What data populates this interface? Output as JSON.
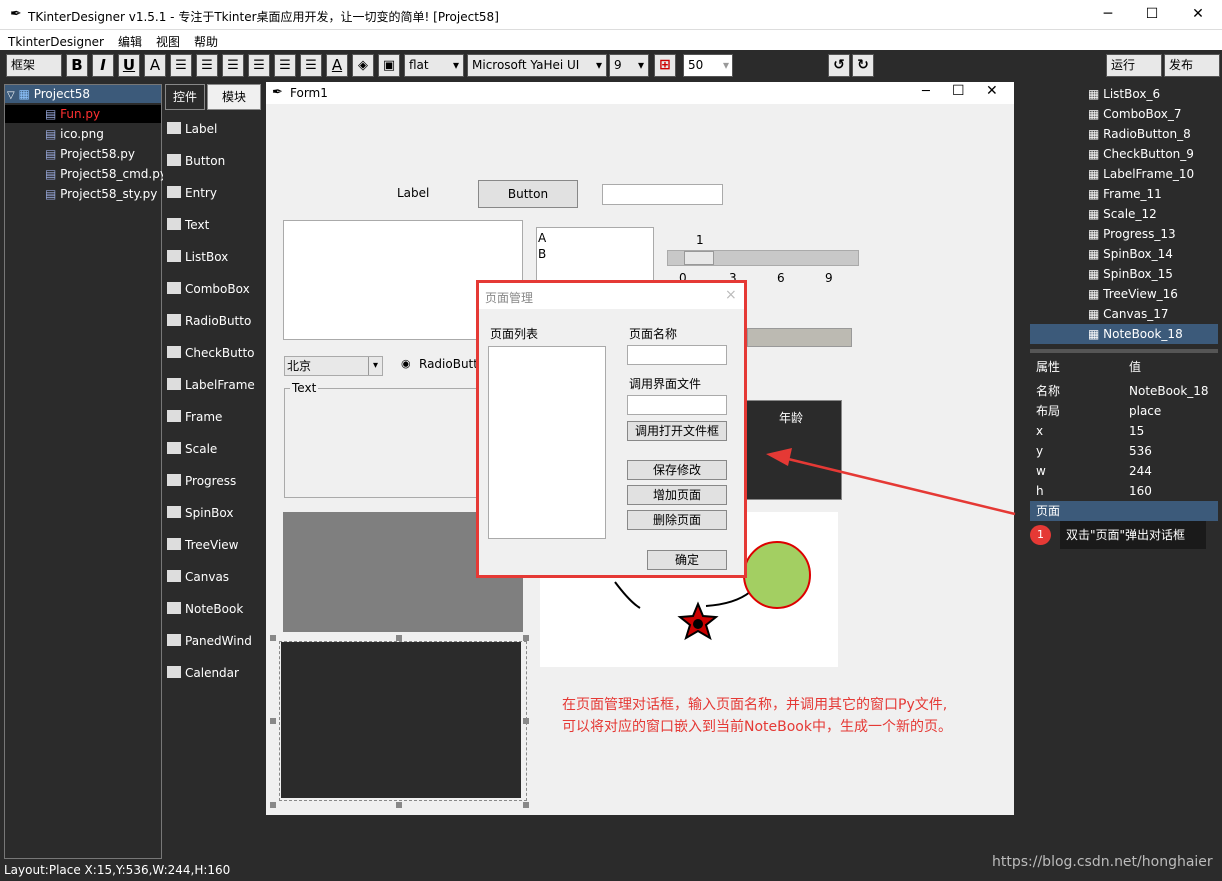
{
  "window": {
    "title": "TKinterDesigner v1.5.1 - 专注于Tkinter桌面应用开发，让一切变的简单!    [Project58]",
    "min": "─",
    "max": "☐",
    "close": "✕"
  },
  "menu": [
    "TkinterDesigner",
    "编辑",
    "视图",
    "帮助"
  ],
  "toolbar": {
    "frame_select": "框架",
    "relief": "flat",
    "font": "Microsoft YaHei UI",
    "font_size": "9",
    "grid_size": "50",
    "run": "运行",
    "publish": "发布",
    "bold": "B",
    "italic": "I",
    "underline": "U",
    "fontcolor": "A"
  },
  "project_tree": {
    "root": "Project58",
    "files": [
      {
        "name": "Fun.py",
        "color": "#ff3030",
        "selected": true
      },
      {
        "name": "ico.png",
        "color": "#ffffff",
        "selected": false
      },
      {
        "name": "Project58.py",
        "color": "#ffffff",
        "selected": false
      },
      {
        "name": "Project58_cmd.py",
        "color": "#ffffff",
        "selected": false
      },
      {
        "name": "Project58_sty.py",
        "color": "#ffffff",
        "selected": false
      }
    ]
  },
  "palette": {
    "tabs": [
      "控件",
      "模块"
    ],
    "items": [
      "Label",
      "Button",
      "Entry",
      "Text",
      "ListBox",
      "ComboBox",
      "RadioButto",
      "CheckButto",
      "LabelFrame",
      "Frame",
      "Scale",
      "Progress",
      "SpinBox",
      "TreeView",
      "Canvas",
      "NoteBook",
      "PanedWind",
      "Calendar"
    ]
  },
  "form": {
    "title": "Form1",
    "label": "Label",
    "button": "Button",
    "listbox_items": [
      "A",
      "B"
    ],
    "scale_value": "1",
    "scale_ticks": [
      "0",
      "3",
      "6",
      "9"
    ],
    "combo_value": "北京",
    "radio_label": "RadioButt",
    "labelframe_title": "Text",
    "tree_header": "年龄"
  },
  "dialog": {
    "title": "页面管理",
    "close": "×",
    "list_label": "页面列表",
    "name_label": "页面名称",
    "file_label": "调用界面文件",
    "open_button": "调用打开文件框",
    "save_button": "保存修改",
    "add_button": "增加页面",
    "delete_button": "删除页面",
    "ok_button": "确定"
  },
  "annotation": {
    "line1": "在页面管理对话框，输入页面名称，并调用其它的窗口Py文件,",
    "line2": "可以将对应的窗口嵌入到当前NoteBook中，生成一个新的页。",
    "badge": "1",
    "tooltip": "双击\"页面\"弹出对话框",
    "color": "#e53935"
  },
  "object_list": [
    "ListBox_6",
    "ComboBox_7",
    "RadioButton_8",
    "CheckButton_9",
    "LabelFrame_10",
    "Frame_11",
    "Scale_12",
    "Progress_13",
    "SpinBox_14",
    "SpinBox_15",
    "TreeView_16",
    "Canvas_17",
    "NoteBook_18"
  ],
  "properties": {
    "header": {
      "name": "属性",
      "value": "值"
    },
    "rows": [
      {
        "name": "名称",
        "value": "NoteBook_18"
      },
      {
        "name": "布局",
        "value": "place"
      },
      {
        "name": "x",
        "value": "15"
      },
      {
        "name": "y",
        "value": "536"
      },
      {
        "name": "w",
        "value": "244"
      },
      {
        "name": "h",
        "value": "160"
      },
      {
        "name": "页面",
        "value": ""
      }
    ]
  },
  "status": {
    "text": "Layout:Place  X:15,Y:536,W:244,H:160",
    "watermark": "https://blog.csdn.net/honghaier"
  }
}
